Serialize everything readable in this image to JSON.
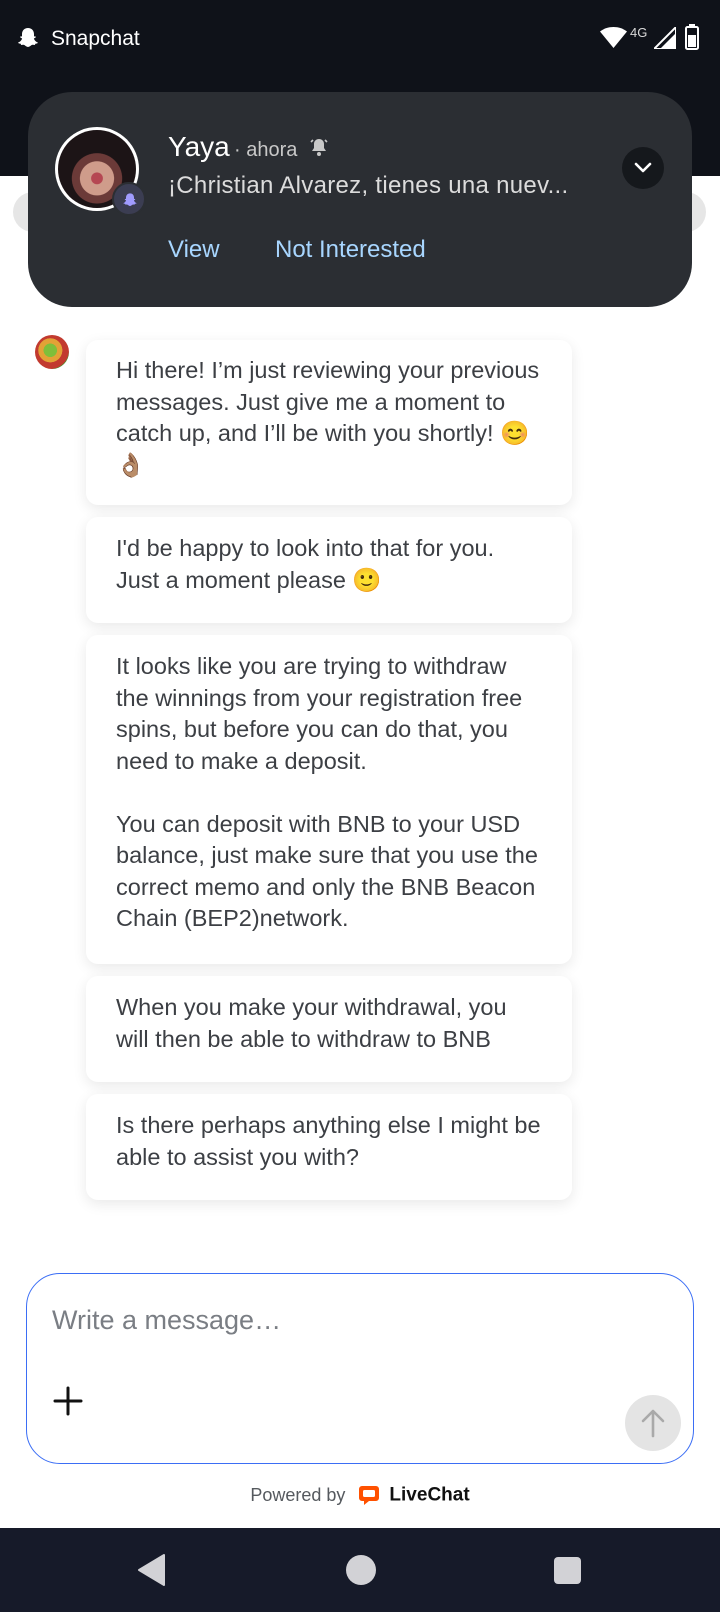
{
  "status_bar": {
    "app_name": "Snapchat",
    "network": "4G",
    "icons": [
      "snapchat-ghost-icon",
      "wifi-icon",
      "cell-signal-icon",
      "battery-icon"
    ]
  },
  "notification": {
    "sender": "Yaya",
    "time": "· ahora",
    "message": "¡Christian Alvarez, tienes una nuev...",
    "actions": {
      "view": "View",
      "not_interested": "Not Interested"
    },
    "icons": [
      "avatar",
      "snapchat-badge-icon",
      "bell-alert-icon",
      "chevron-down-icon"
    ]
  },
  "chat": {
    "messages": [
      "Hi there! I’m just reviewing your previous messages. Just give me a moment to catch up, and I’ll be with you shortly! 😊 👌🏽",
      "I'd be happy to look into that for you. Just a moment please 🙂",
      "It looks like you are trying to withdraw the winnings from your registration free spins, but before you can do that, you need to make a deposit.\n\nYou can deposit with BNB to your USD balance, just make sure that you use the correct memo and only the BNB Beacon Chain (BEP2)network.",
      "When you make your withdrawal, you will then be able to withdraw to BNB",
      "Is there perhaps anything else I might be able to assist you with?"
    ]
  },
  "composer": {
    "placeholder": "Write a message…",
    "value": ""
  },
  "footer": {
    "powered_by": "Powered by",
    "brand": "LiveChat",
    "brand_color": "#ff5100"
  },
  "colors": {
    "dark_bar": "#0f1219",
    "notification_bg": "#2b2e33",
    "action_link": "#a8d6ff",
    "composer_border": "#3b6ef5",
    "nav_bar": "#161a29"
  }
}
